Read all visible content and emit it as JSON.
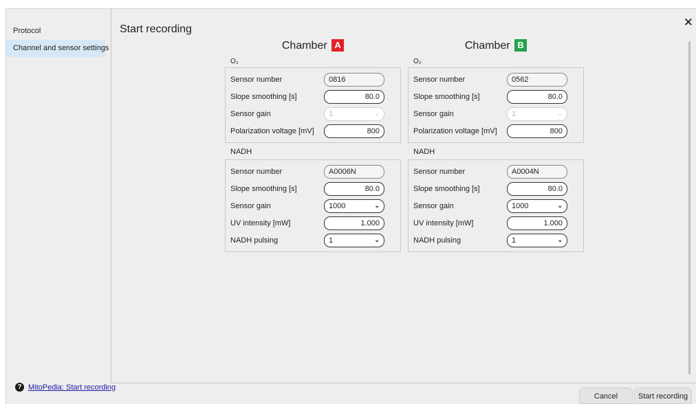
{
  "sidebar": {
    "items": [
      {
        "label": "Protocol"
      },
      {
        "label": "Channel and sensor settings"
      }
    ]
  },
  "page": {
    "title": "Start recording",
    "close_glyph": "✕"
  },
  "chambers": [
    {
      "title": "Chamber",
      "badge": "A",
      "badge_color": "#e22228",
      "o2_label": "O₂",
      "o2": {
        "sensor_number_label": "Sensor number",
        "sensor_number": "0816",
        "slope_label": "Slope smoothing [s]",
        "slope": "80.0",
        "gain_label": "Sensor gain",
        "gain": "1",
        "pol_label": "Polarization voltage [mV]",
        "pol": "800"
      },
      "nadh_label": "NADH",
      "nadh": {
        "sensor_number_label": "Sensor number",
        "sensor_number": "A0006N",
        "slope_label": "Slope smoothing [s]",
        "slope": "80.0",
        "gain_label": "Sensor gain",
        "gain": "1000",
        "uv_label": "UV intensity [mW]",
        "uv": "1.000",
        "pulsing_label": "NADH pulsing",
        "pulsing": "1"
      }
    },
    {
      "title": "Chamber",
      "badge": "B",
      "badge_color": "#25a24a",
      "o2_label": "O₂",
      "o2": {
        "sensor_number_label": "Sensor number",
        "sensor_number": "0562",
        "slope_label": "Slope smoothing [s]",
        "slope": "80.0",
        "gain_label": "Sensor gain",
        "gain": "1",
        "pol_label": "Polarization voltage [mV]",
        "pol": "800"
      },
      "nadh_label": "NADH",
      "nadh": {
        "sensor_number_label": "Sensor number",
        "sensor_number": "A0004N",
        "slope_label": "Slope smoothing [s]",
        "slope": "80.0",
        "gain_label": "Sensor gain",
        "gain": "1000",
        "uv_label": "UV intensity [mW]",
        "uv": "1.000",
        "pulsing_label": "NADH pulsing",
        "pulsing": "1"
      }
    }
  ],
  "footer": {
    "help_icon": "?",
    "help_link": "MitoPedia: Start recording",
    "cancel_label": "Cancel",
    "start_label": "Start recording"
  }
}
